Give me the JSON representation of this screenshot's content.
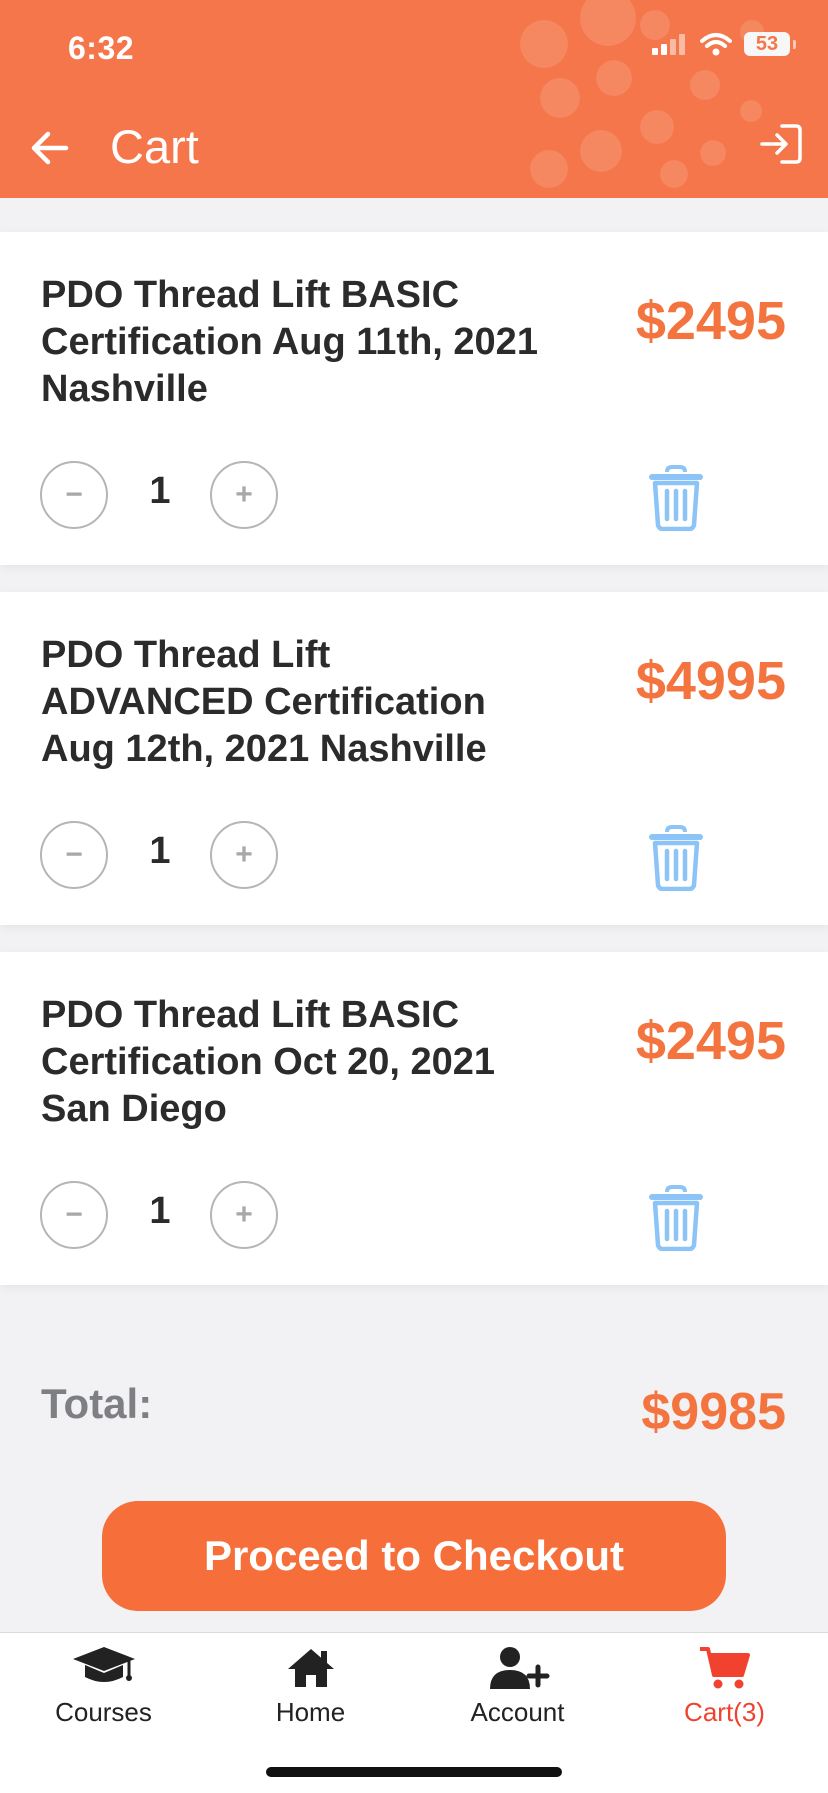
{
  "status_bar": {
    "time": "6:32",
    "battery": "53"
  },
  "nav": {
    "title": "Cart"
  },
  "cart_items": [
    {
      "title": "PDO Thread Lift BASIC Certification Aug 11th, 2021 Nashville",
      "price": "$2495",
      "quantity": "1"
    },
    {
      "title": "PDO Thread Lift ADVANCED Certification Aug 12th, 2021 Nashville",
      "price": "$4995",
      "quantity": "1"
    },
    {
      "title": "PDO Thread Lift BASIC Certification Oct 20, 2021 San Diego",
      "price": "$2495",
      "quantity": "1"
    }
  ],
  "qty_controls": {
    "minus": "−",
    "plus": "+"
  },
  "summary": {
    "total_label": "Total:",
    "total_value": "$9985"
  },
  "checkout": {
    "label": "Proceed to Checkout"
  },
  "tabs": [
    {
      "label": "Courses",
      "icon": "graduation-cap-icon"
    },
    {
      "label": "Home",
      "icon": "home-icon"
    },
    {
      "label": "Account",
      "icon": "user-plus-icon"
    },
    {
      "label": "Cart(3)",
      "icon": "cart-icon",
      "active": true
    }
  ],
  "colors": {
    "accent": "#f4764a",
    "price": "#f4743f",
    "active_tab": "#f0422f",
    "trash": "#8cc4f7"
  }
}
